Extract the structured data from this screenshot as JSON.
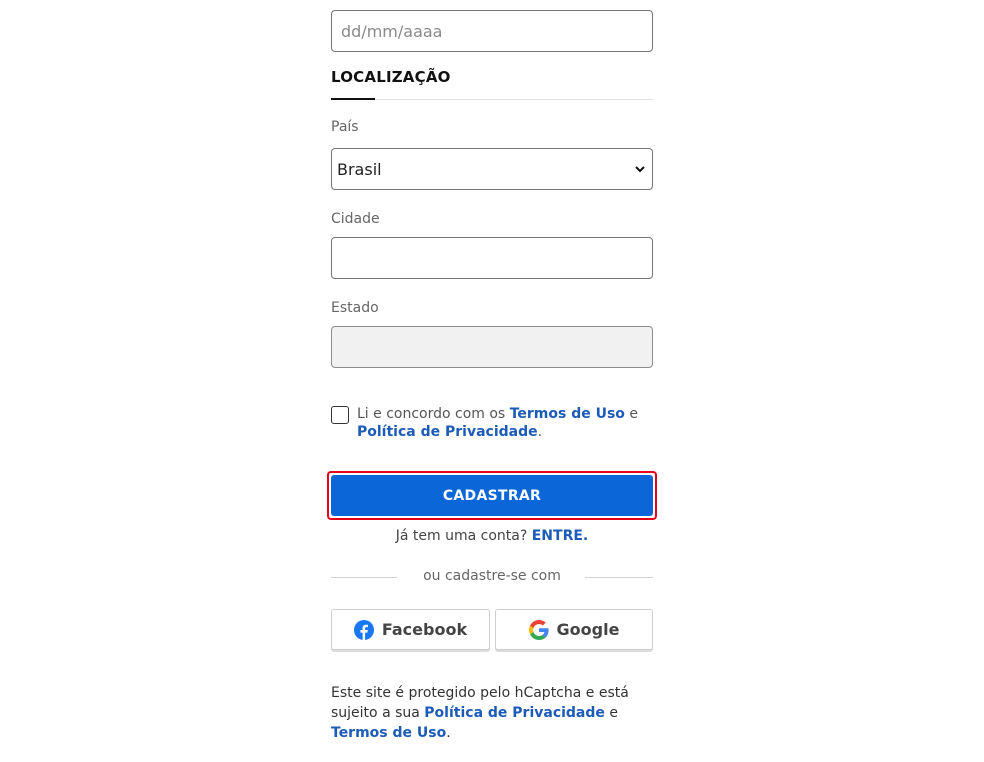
{
  "birth_date": {
    "placeholder": "dd/mm/aaaa"
  },
  "location": {
    "title": "LOCALIZAÇÃO",
    "country_label": "País",
    "country_value": "Brasil",
    "city_label": "Cidade",
    "city_value": "",
    "state_label": "Estado",
    "state_value": ""
  },
  "terms": {
    "text_before": "Li e concordo com os ",
    "terms_link": "Termos de Uso",
    "text_middle": " e ",
    "privacy_link": "Política de Privacidade",
    "text_after": "."
  },
  "submit": {
    "label": "CADASTRAR",
    "highlight_color": "#e3001b",
    "button_color": "#0b67d8"
  },
  "login": {
    "question": "Já tem uma conta?",
    "link": "ENTRE."
  },
  "social": {
    "divider_text": "ou cadastre-se com",
    "facebook_label": "Facebook",
    "google_label": "Google",
    "facebook_icon": "facebook-icon",
    "google_icon": "google-icon"
  },
  "footer": {
    "text_before": "Este site é protegido pelo hCaptcha e está sujeito a sua ",
    "privacy_link": "Política de Privacidade",
    "text_middle": " e ",
    "terms_link": "Termos de Uso",
    "text_after": "."
  },
  "colors": {
    "link": "#1c5bb8"
  }
}
